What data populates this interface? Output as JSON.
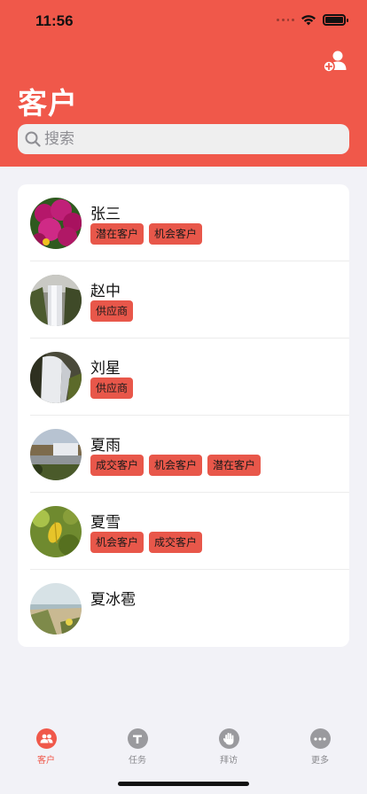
{
  "status_bar": {
    "time": "11:56"
  },
  "header": {
    "title": "客户",
    "add_icon": "add-user-icon"
  },
  "search": {
    "placeholder": "搜索"
  },
  "customers": [
    {
      "name": "张三",
      "tags": [
        "潜在客户",
        "机会客户"
      ],
      "avatar": "purple-flowers"
    },
    {
      "name": "赵中",
      "tags": [
        "供应商"
      ],
      "avatar": "waterfall-misty"
    },
    {
      "name": "刘星",
      "tags": [
        "供应商"
      ],
      "avatar": "waterfall-rocks"
    },
    {
      "name": "夏雨",
      "tags": [
        "成交客户",
        "机会客户",
        "潜在客户"
      ],
      "avatar": "waterfall-wide"
    },
    {
      "name": "夏雪",
      "tags": [
        "机会客户",
        "成交客户"
      ],
      "avatar": "yellow-leaf"
    },
    {
      "name": "夏冰雹",
      "tags": [],
      "avatar": "beach-grass"
    }
  ],
  "tabs": [
    {
      "label": "客户",
      "icon": "people-icon",
      "active": true
    },
    {
      "label": "任务",
      "icon": "task-icon",
      "active": false
    },
    {
      "label": "拜访",
      "icon": "hand-icon",
      "active": false
    },
    {
      "label": "更多",
      "icon": "more-icon",
      "active": false
    }
  ],
  "colors": {
    "accent": "#f0584a",
    "tag": "#e8574a",
    "inactive": "#9a9a9e"
  }
}
